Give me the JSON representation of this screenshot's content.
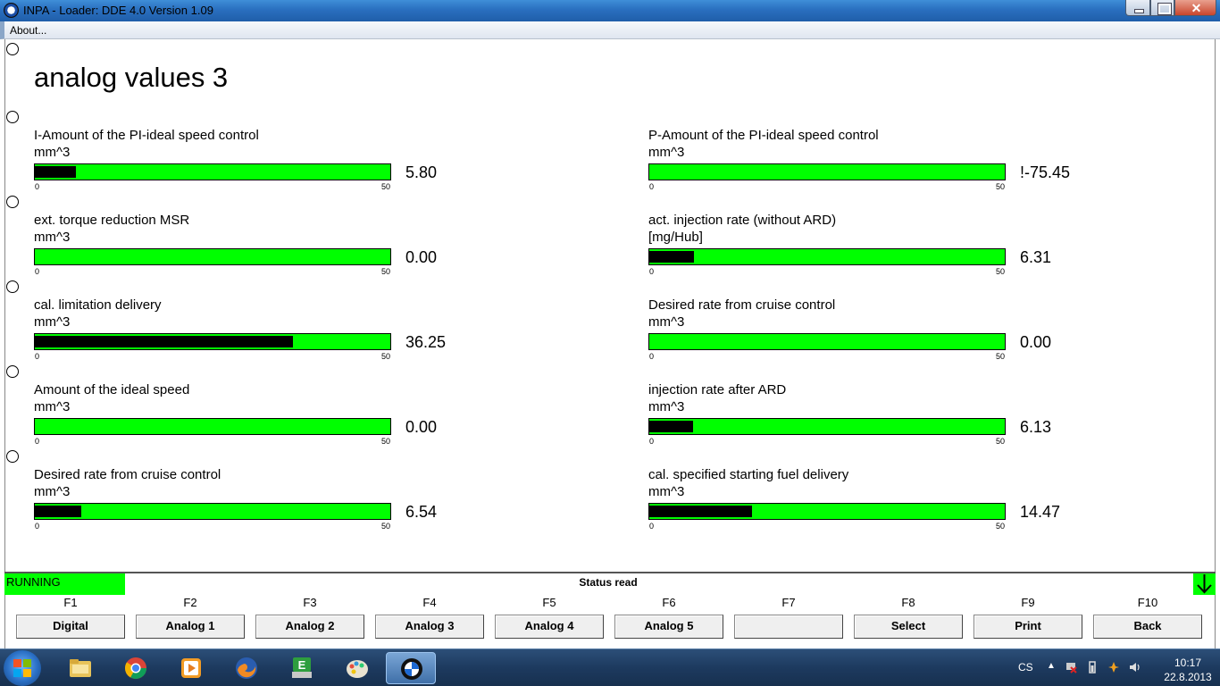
{
  "window": {
    "title": "INPA - Loader:  DDE 4.0 Version 1.09"
  },
  "menu": {
    "about_label": "About..."
  },
  "page": {
    "title": "analog values 3"
  },
  "meters_left": [
    {
      "label": "I-Amount of the PI-ideal speed control",
      "unit": "mm^3",
      "value": "5.80",
      "min": "0",
      "max": "50",
      "fill": 0.116
    },
    {
      "label": "ext. torque reduction MSR",
      "unit": "mm^3",
      "value": "0.00",
      "min": "0",
      "max": "50",
      "fill": 0.0
    },
    {
      "label": "cal. limitation delivery",
      "unit": "mm^3",
      "value": "36.25",
      "min": "0",
      "max": "50",
      "fill": 0.725
    },
    {
      "label": "Amount of the ideal speed",
      "unit": "mm^3",
      "value": "0.00",
      "min": "0",
      "max": "50",
      "fill": 0.0
    },
    {
      "label": "Desired rate from cruise control",
      "unit": "mm^3",
      "value": "6.54",
      "min": "0",
      "max": "50",
      "fill": 0.131
    }
  ],
  "meters_right": [
    {
      "label": "P-Amount of the PI-ideal speed control",
      "unit": "mm^3",
      "value": "!-75.45",
      "min": "0",
      "max": "50",
      "fill": 0.0
    },
    {
      "label": "act. injection rate (without ARD)",
      "unit": "[mg/Hub]",
      "value": "6.31",
      "min": "0",
      "max": "50",
      "fill": 0.126
    },
    {
      "label": "Desired rate from cruise control",
      "unit": "mm^3",
      "value": "0.00",
      "min": "0",
      "max": "50",
      "fill": 0.0
    },
    {
      "label": "injection rate after ARD",
      "unit": "mm^3",
      "value": "6.13",
      "min": "0",
      "max": "50",
      "fill": 0.123
    },
    {
      "label": "cal. specified starting fuel delivery",
      "unit": "mm^3",
      "value": "14.47",
      "min": "0",
      "max": "50",
      "fill": 0.289
    }
  ],
  "status": {
    "running": "RUNNING",
    "text": "Status read"
  },
  "fkeys": [
    {
      "key": "F1",
      "label": "Digital"
    },
    {
      "key": "F2",
      "label": "Analog 1"
    },
    {
      "key": "F3",
      "label": "Analog 2"
    },
    {
      "key": "F4",
      "label": "Analog 3"
    },
    {
      "key": "F5",
      "label": "Analog 4"
    },
    {
      "key": "F6",
      "label": "Analog 5"
    },
    {
      "key": "F7",
      "label": ""
    },
    {
      "key": "F8",
      "label": "Select"
    },
    {
      "key": "F9",
      "label": "Print"
    },
    {
      "key": "F10",
      "label": "Back"
    }
  ],
  "taskbar": {
    "apps": [
      "folder-icon",
      "chrome-icon",
      "media-player-icon",
      "firefox-icon",
      "ediabas-icon",
      "paint-icon",
      "bmw-inpa-icon"
    ],
    "lang": "CS",
    "time": "10:17",
    "date": "22.8.2013"
  },
  "colors": {
    "meter_bar": "#00ff00",
    "meter_fill": "#000000",
    "status_running": "#00ff00"
  }
}
